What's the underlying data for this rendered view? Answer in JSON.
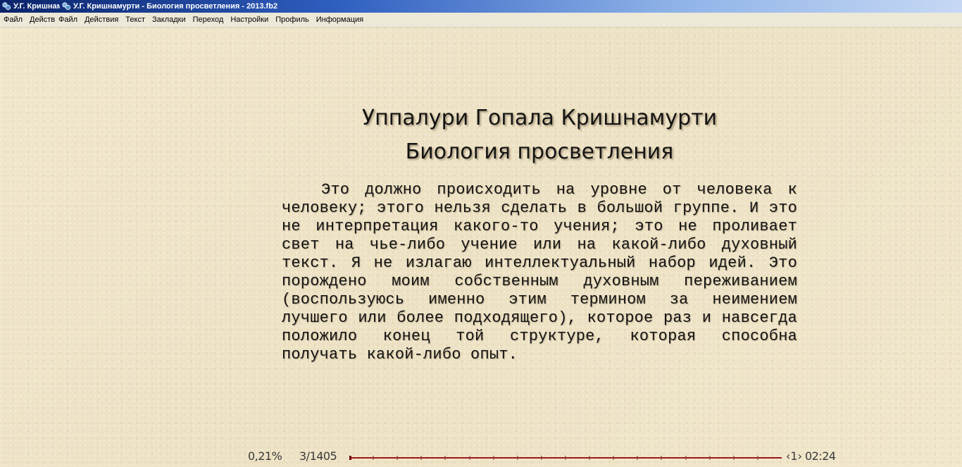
{
  "window": {
    "short_title": "У.Г. Кришнамурти - Биология просветления - 2013.fb2",
    "title": "У.Г. Кришнамурти - Биология просветления - 2013.fb2",
    "title_bar_color": "#0a246a"
  },
  "menu": {
    "items": [
      {
        "label": "Файл"
      },
      {
        "label": "Действия"
      },
      {
        "label": "Файл"
      },
      {
        "label": "Действия"
      },
      {
        "label": "Текст"
      },
      {
        "label": "Закладки"
      },
      {
        "label": "Переход"
      },
      {
        "label": "Настройки"
      },
      {
        "label": "Профиль"
      },
      {
        "label": "Информация"
      }
    ]
  },
  "book": {
    "author": "Уппалури Гопала Кришнамурти",
    "title": "Биология просветления",
    "paragraph": "Это должно происходить на уровне от человека к человеку; этого нельзя сделать в большой группе. И это не интерпретация какого-то учения; это не проливает свет на чье-либо учение или на какой-либо духовный текст. Я не излагаю интеллектуальный набор идей. Это порождено моим собственным духовным переживанием (воспользуюсь именно этим термином за неимением лучшего или более подходящего), которое раз и навсегда положило конец той структуре, которая способна получать какой-либо опыт."
  },
  "status": {
    "percent_text": "0,21%",
    "pages_text": "3/1405",
    "progress_fraction": 0.0021,
    "nav_text": "‹1›",
    "time_text": "02:24",
    "progress_color": "#9a1a1a"
  },
  "background_color": "#efe4c8"
}
